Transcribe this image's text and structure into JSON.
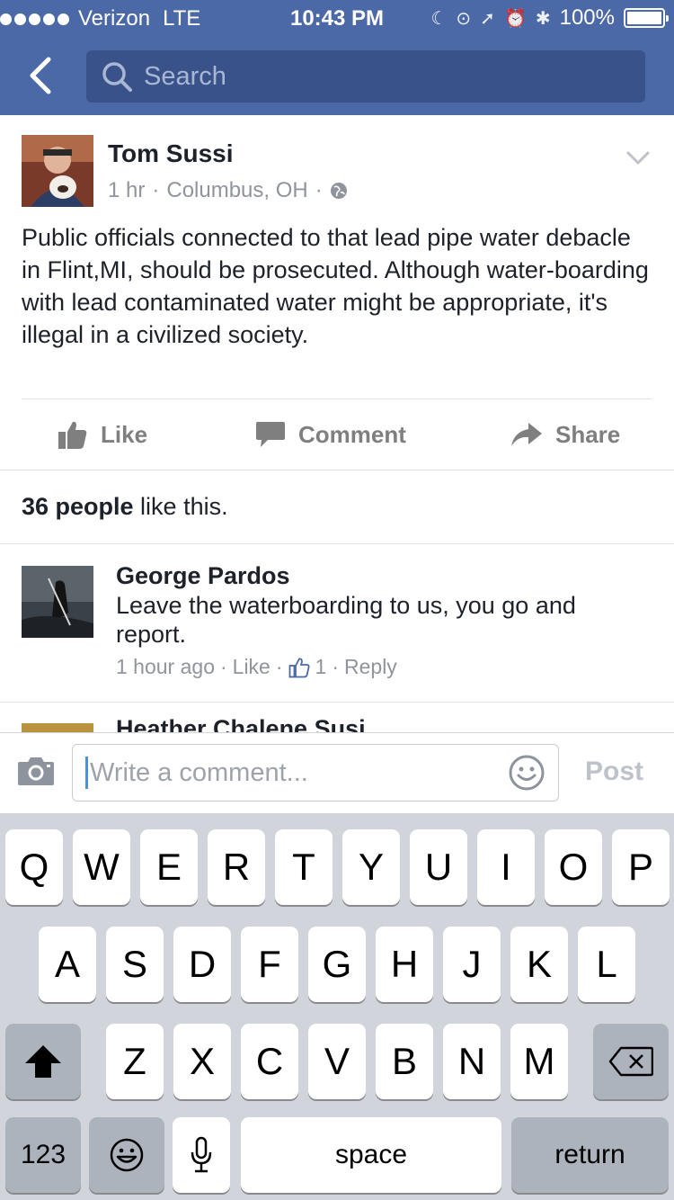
{
  "status_bar": {
    "carrier": "Verizon",
    "network": "LTE",
    "time": "10:43 PM",
    "battery": "100%",
    "battery_level": 1.0
  },
  "nav": {
    "search_placeholder": "Search"
  },
  "post": {
    "author": "Tom Sussi",
    "time": "1 hr",
    "location": "Columbus, OH",
    "separator": "·",
    "text": "Public officials connected to that lead pipe water debacle in Flint,MI, should be prosecuted. Although water-boarding with lead contaminated water might be appropriate, it's illegal in a civilized society.",
    "actions": {
      "like": "Like",
      "comment": "Comment",
      "share": "Share"
    },
    "likes_count": "36 people",
    "likes_suffix": " like this."
  },
  "comments": [
    {
      "author": "George Pardos",
      "text": "Leave the waterboarding to us, you go and report.",
      "time": "1 hour ago",
      "like": "Like",
      "like_count": "1",
      "reply": "Reply"
    },
    {
      "author": "Heather Chalene Susi"
    }
  ],
  "composer": {
    "placeholder": "Write a comment...",
    "post": "Post"
  },
  "keyboard": {
    "row1": [
      "Q",
      "W",
      "E",
      "R",
      "T",
      "Y",
      "U",
      "I",
      "O",
      "P"
    ],
    "row2": [
      "A",
      "S",
      "D",
      "F",
      "G",
      "H",
      "J",
      "K",
      "L"
    ],
    "row3": [
      "Z",
      "X",
      "C",
      "V",
      "B",
      "N",
      "M"
    ],
    "numbers": "123",
    "space": "space",
    "return": "return"
  },
  "colors": {
    "header": "#4b69a6",
    "search_bg": "#39538a",
    "keyboard_bg": "#d1d5db"
  }
}
